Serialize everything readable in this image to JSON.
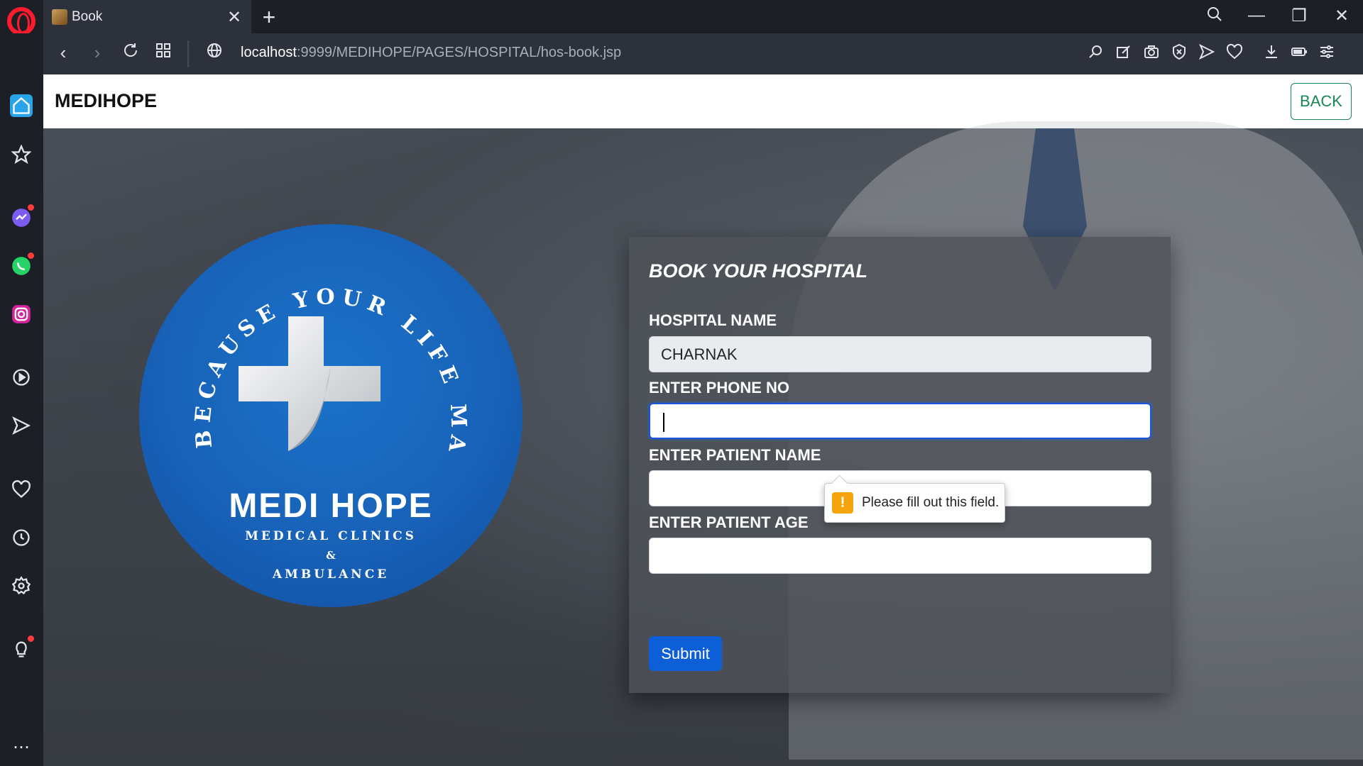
{
  "browser": {
    "tab_title": "Book",
    "url_host": "localhost",
    "url_path": ":9999/MEDIHOPE/PAGES/HOSPITAL/hos-book.jsp"
  },
  "sidebar": {
    "items": [
      "home-icon",
      "star-icon",
      "messenger-icon",
      "whatsapp-icon",
      "instagram-icon",
      "player-icon",
      "send-icon",
      "heart-icon",
      "history-icon",
      "settings-icon",
      "lightbulb-icon",
      "more-icon"
    ]
  },
  "header": {
    "brand": "MEDIHOPE",
    "back_label": "BACK"
  },
  "logo": {
    "arc_text": "BECAUSE YOUR LIFE MATTERS",
    "title": "MEDI HOPE",
    "line1": "MEDICAL CLINICS",
    "amp": "&",
    "line2": "AMBULANCE"
  },
  "form": {
    "title": "BOOK YOUR HOSPITAL",
    "hospital_label": "HOSPITAL NAME",
    "hospital_value": "CHARNAK",
    "phone_label": "ENTER PHONE NO",
    "phone_value": "",
    "patient_name_label": "ENTER PATIENT NAME",
    "patient_name_value": "",
    "patient_age_label": "ENTER PATIENT AGE",
    "patient_age_value": "",
    "submit_label": "Submit"
  },
  "validation": {
    "message": "Please fill out this field.",
    "icon": "!"
  },
  "colors": {
    "accent": "#0d5fd8",
    "back_button": "#198754",
    "warning": "#f7a30c"
  }
}
